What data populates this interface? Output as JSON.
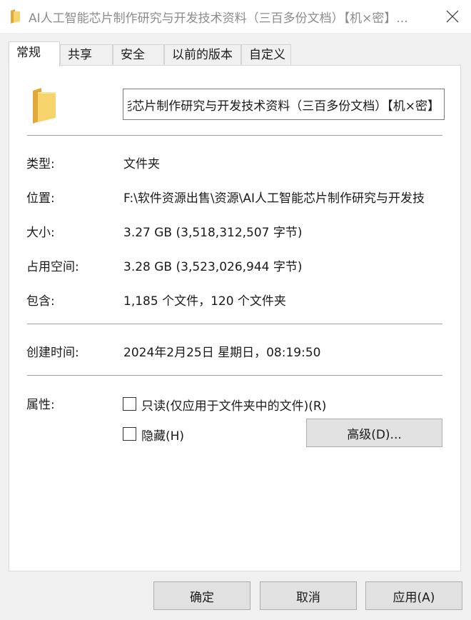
{
  "window": {
    "title": "AI人工智能芯片制作研究与开发技术资料（三百多份文档）【机×密】..."
  },
  "tabs": [
    {
      "label": "常规",
      "active": true
    },
    {
      "label": "共享",
      "active": false
    },
    {
      "label": "安全",
      "active": false
    },
    {
      "label": "以前的版本",
      "active": false
    },
    {
      "label": "自定义",
      "active": false
    }
  ],
  "general": {
    "name_value": "AI人工智能芯片制作研究与开发技术资料（三百多份文档）【机×密】",
    "type_label": "类型:",
    "type_value": "文件夹",
    "location_label": "位置:",
    "location_value": "F:\\软件资源出售\\资源\\AI人工智能芯片制作研究与开发技",
    "size_label": "大小:",
    "size_value": "3.27 GB (3,518,312,507 字节)",
    "disk_size_label": "占用空间:",
    "disk_size_value": "3.28 GB (3,523,026,944 字节)",
    "contains_label": "包含:",
    "contains_value": "1,185 个文件，120 个文件夹",
    "created_label": "创建时间:",
    "created_value": "2024年2月25日 星期日，08:19:50",
    "attributes_label": "属性:",
    "readonly_label": "只读(仅应用于文件夹中的文件)(R)",
    "readonly_checked": false,
    "hidden_label": "隐藏(H)",
    "hidden_checked": false,
    "advanced_button": "高级(D)..."
  },
  "footer": {
    "ok": "确定",
    "cancel": "取消",
    "apply": "应用(A)"
  },
  "colors": {
    "folder_yellow": "#f7d36b",
    "folder_dark": "#e0a93a"
  }
}
